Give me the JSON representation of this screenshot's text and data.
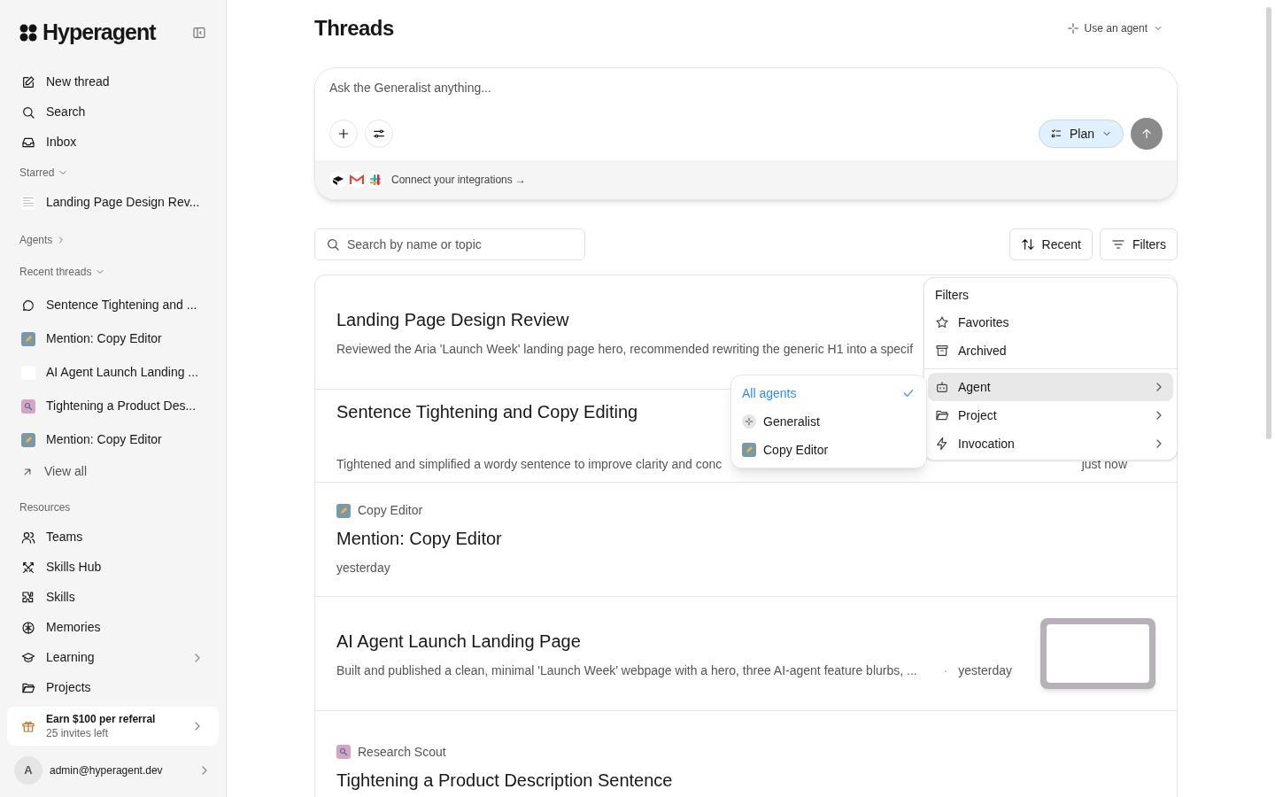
{
  "sidebar": {
    "brand": "Hyperagent",
    "nav": [
      {
        "label": "New thread"
      },
      {
        "label": "Search"
      },
      {
        "label": "Inbox"
      }
    ],
    "starred": {
      "label": "Starred",
      "expanded": true,
      "items": [
        {
          "label": "Landing Page Design Rev..."
        }
      ]
    },
    "agents": {
      "label": "Agents",
      "expanded": false
    },
    "recent": {
      "label": "Recent threads",
      "expanded": true,
      "items": [
        {
          "label": "Sentence Tightening and ..."
        },
        {
          "label": "Mention: Copy Editor"
        },
        {
          "label": "AI Agent Launch Landing ..."
        },
        {
          "label": "Tightening a Product Des..."
        },
        {
          "label": "Mention: Copy Editor"
        }
      ],
      "view_all": "View all"
    },
    "resources": {
      "label": "Resources",
      "items": [
        {
          "label": "Teams",
          "submenu": false
        },
        {
          "label": "Skills Hub",
          "submenu": false
        },
        {
          "label": "Skills",
          "submenu": false
        },
        {
          "label": "Memories",
          "submenu": false
        },
        {
          "label": "Learning",
          "submenu": true
        },
        {
          "label": "Projects",
          "submenu": false
        }
      ]
    },
    "referral": {
      "title": "Earn $100 per referral",
      "subtitle": "25 invites left"
    },
    "account": {
      "avatar": "A",
      "email": "admin@hyperagent.dev"
    }
  },
  "main": {
    "title": "Threads",
    "agent_button": "Use an agent",
    "composer": {
      "placeholder": "Ask the Generalist anything...",
      "mode": "Plan",
      "integrations": "Connect your integrations →"
    },
    "search": {
      "placeholder": "Search by name or topic"
    },
    "sort": "Recent",
    "filters": "Filters",
    "threads": [
      {
        "title": "Landing Page Design Review",
        "description": "Reviewed the Aria 'Launch Week' landing page hero, recommended rewriting the generic H1 into a specif"
      },
      {
        "title": "Sentence Tightening and Copy Editing",
        "description": "Tightened and simplified a wordy sentence to improve clarity and conc",
        "date": "just now"
      },
      {
        "agent": "Copy Editor",
        "title": "Mention: Copy Editor",
        "date": "yesterday"
      },
      {
        "title": "AI Agent Launch Landing Page",
        "description": "Built and published a clean, minimal 'Launch Week' webpage with a hero, three AI-agent feature blurbs, ...",
        "separator": "·",
        "date": "yesterday",
        "thumbnail": true
      },
      {
        "agent": "Research Scout",
        "title": "Tightening a Product Description Sentence"
      }
    ],
    "filters_menu": {
      "title": "Filters",
      "items": [
        {
          "label": "Favorites",
          "kind": "toggle",
          "selected": false
        },
        {
          "label": "Archived",
          "kind": "toggle",
          "selected": false
        },
        {
          "label": "Agent",
          "kind": "submenu",
          "selected": true
        },
        {
          "label": "Project",
          "kind": "submenu",
          "selected": false
        },
        {
          "label": "Invocation",
          "kind": "submenu",
          "selected": false
        }
      ]
    },
    "agent_menu": [
      {
        "label": "All agents",
        "selected": true
      },
      {
        "label": "Generalist",
        "selected": false
      },
      {
        "label": "Copy Editor",
        "selected": false
      }
    ]
  }
}
